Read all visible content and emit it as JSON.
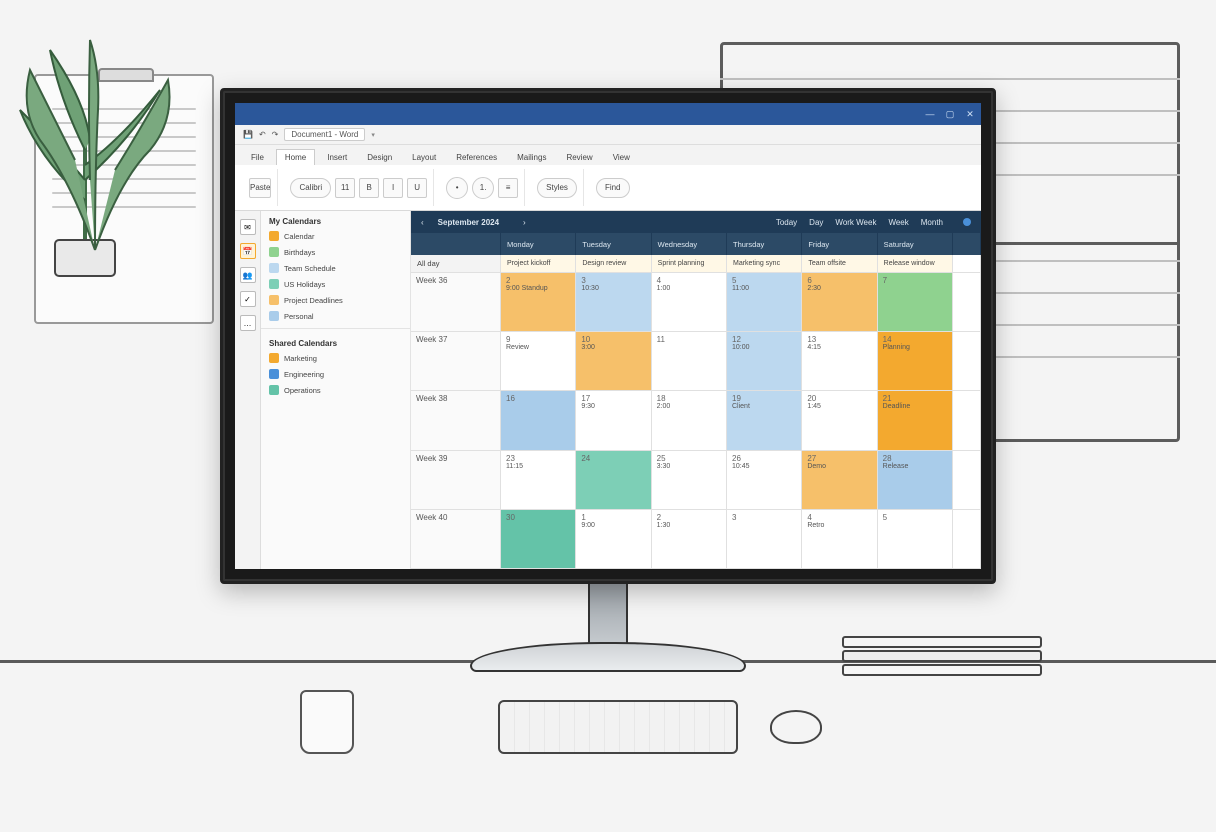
{
  "titlebar": {
    "min": "—",
    "max": "▢",
    "close": "✕"
  },
  "qat": {
    "doc_name": "Document1 - Word",
    "save_icon": "💾",
    "undo_icon": "↶",
    "redo_icon": "↷"
  },
  "ribbon_tabs": [
    "File",
    "Home",
    "Insert",
    "Design",
    "Layout",
    "References",
    "Mailings",
    "Review",
    "View"
  ],
  "ribbon_active_tab": "Home",
  "ribbon": {
    "paste": "Paste",
    "font_name": "Calibri",
    "font_size": "11",
    "bold": "B",
    "italic": "I",
    "underline": "U",
    "bullets": "•",
    "numbering": "1.",
    "align_left": "≡",
    "styles": "Styles",
    "find": "Find"
  },
  "nav_icons": [
    "✉",
    "📅",
    "👥",
    "✓",
    "…"
  ],
  "nav_active": 1,
  "sidebar": {
    "heading": "My Calendars",
    "items": [
      {
        "label": "Calendar",
        "color": "#f3a92f"
      },
      {
        "label": "Birthdays",
        "color": "#8fd28f"
      },
      {
        "label": "Team Schedule",
        "color": "#bcd8ef"
      },
      {
        "label": "US Holidays",
        "color": "#7dcfb6"
      },
      {
        "label": "Project Deadlines",
        "color": "#f6c06a"
      },
      {
        "label": "Personal",
        "color": "#a9ccea"
      }
    ],
    "heading2": "Shared Calendars",
    "items2": [
      {
        "label": "Marketing",
        "color": "#f3a92f"
      },
      {
        "label": "Engineering",
        "color": "#4a90d9"
      },
      {
        "label": "Operations",
        "color": "#64c3a8"
      }
    ]
  },
  "calendar": {
    "toolbar": {
      "title": "September 2024",
      "tabs": [
        "Today",
        "Day",
        "Work Week",
        "Week",
        "Month"
      ]
    },
    "columns": [
      "",
      "Monday",
      "Tuesday",
      "Wednesday",
      "Thursday",
      "Friday",
      "Saturday",
      ""
    ],
    "allday_label": "All day",
    "allday_events": [
      "Project kickoff",
      "Design review",
      "Sprint planning",
      "Marketing sync",
      "Team offsite",
      "Release window"
    ],
    "rows": [
      {
        "label": "Week 36",
        "cells": [
          {
            "n": "2",
            "t": "9:00 Standup",
            "c": "c-orange"
          },
          {
            "n": "3",
            "t": "10:30",
            "c": "c-lblue"
          },
          {
            "n": "4",
            "t": "1:00",
            "c": ""
          },
          {
            "n": "5",
            "t": "11:00",
            "c": "c-lblue"
          },
          {
            "n": "6",
            "t": "2:30",
            "c": "c-orange"
          },
          {
            "n": "7",
            "t": "",
            "c": "c-green"
          }
        ]
      },
      {
        "label": "Week 37",
        "cells": [
          {
            "n": "9",
            "t": "Review",
            "c": ""
          },
          {
            "n": "10",
            "t": "3:00",
            "c": "c-orange"
          },
          {
            "n": "11",
            "t": "",
            "c": ""
          },
          {
            "n": "12",
            "t": "10:00",
            "c": "c-lblue"
          },
          {
            "n": "13",
            "t": "4:15",
            "c": ""
          },
          {
            "n": "14",
            "t": "Planning",
            "c": "c-orange2"
          }
        ]
      },
      {
        "label": "Week 38",
        "cells": [
          {
            "n": "16",
            "t": "",
            "c": "c-blue"
          },
          {
            "n": "17",
            "t": "9:30",
            "c": ""
          },
          {
            "n": "18",
            "t": "2:00",
            "c": ""
          },
          {
            "n": "19",
            "t": "Client",
            "c": "c-lblue"
          },
          {
            "n": "20",
            "t": "1:45",
            "c": ""
          },
          {
            "n": "21",
            "t": "Deadline",
            "c": "c-orange2"
          }
        ]
      },
      {
        "label": "Week 39",
        "cells": [
          {
            "n": "23",
            "t": "11:15",
            "c": ""
          },
          {
            "n": "24",
            "t": "",
            "c": "c-teal"
          },
          {
            "n": "25",
            "t": "3:30",
            "c": ""
          },
          {
            "n": "26",
            "t": "10:45",
            "c": ""
          },
          {
            "n": "27",
            "t": "Demo",
            "c": "c-orange"
          },
          {
            "n": "28",
            "t": "Release",
            "c": "c-blue"
          }
        ]
      },
      {
        "label": "Week 40",
        "cells": [
          {
            "n": "30",
            "t": "",
            "c": "c-teal2"
          },
          {
            "n": "1",
            "t": "9:00",
            "c": ""
          },
          {
            "n": "2",
            "t": "1:30",
            "c": ""
          },
          {
            "n": "3",
            "t": "",
            "c": ""
          },
          {
            "n": "4",
            "t": "Retro",
            "c": ""
          },
          {
            "n": "5",
            "t": "",
            "c": ""
          }
        ]
      }
    ]
  }
}
